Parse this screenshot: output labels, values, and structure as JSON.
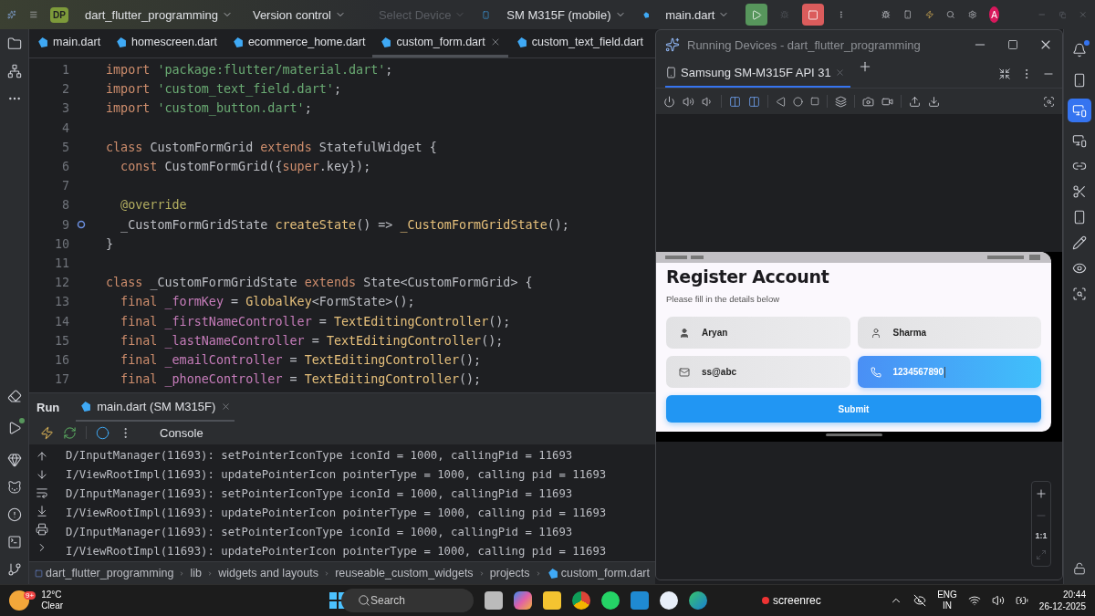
{
  "title_bar": {
    "project_badge": "DP",
    "project": "dart_flutter_programming",
    "vcs": "Version control",
    "device_selector": {
      "label": "Select Device",
      "disabled": true
    },
    "device": "SM M315F (mobile)",
    "run_config": "main.dart",
    "avatar": "A"
  },
  "editor_tabs": [
    {
      "label": "main.dart",
      "selected": false
    },
    {
      "label": "homescreen.dart",
      "selected": false
    },
    {
      "label": "ecommerce_home.dart",
      "selected": false
    },
    {
      "label": "custom_form.dart",
      "selected": true
    },
    {
      "label": "custom_text_field.dart",
      "selected": false
    }
  ],
  "code_lines": [
    {
      "number": "1",
      "marker": false,
      "tokens": [
        {
          "kind": "kw",
          "t": "import "
        },
        {
          "kind": "str",
          "t": "'package:flutter/material.dart'"
        },
        {
          "kind": "plain",
          "t": ";"
        }
      ]
    },
    {
      "number": "2",
      "marker": false,
      "tokens": [
        {
          "kind": "kw",
          "t": "import "
        },
        {
          "kind": "str",
          "t": "'custom_text_field.dart'"
        },
        {
          "kind": "plain",
          "t": ";"
        }
      ]
    },
    {
      "number": "3",
      "marker": false,
      "tokens": [
        {
          "kind": "kw",
          "t": "import "
        },
        {
          "kind": "str",
          "t": "'custom_button.dart'"
        },
        {
          "kind": "plain",
          "t": ";"
        }
      ]
    },
    {
      "number": "4",
      "marker": false
    },
    {
      "number": "5",
      "marker": false,
      "tokens": [
        {
          "kind": "kw",
          "t": "class "
        },
        {
          "kind": "plain",
          "t": "CustomFormGrid "
        },
        {
          "kind": "kw",
          "t": "extends "
        },
        {
          "kind": "plain",
          "t": "StatefulWidget {"
        }
      ]
    },
    {
      "number": "6",
      "marker": false,
      "tokens": [
        {
          "kind": "kw",
          "t": "  const "
        },
        {
          "kind": "plain",
          "t": "CustomFormGrid({"
        },
        {
          "kind": "kw",
          "t": "super"
        },
        {
          "kind": "plain",
          "t": ".key});"
        }
      ]
    },
    {
      "number": "7",
      "marker": false
    },
    {
      "number": "8",
      "marker": false,
      "tokens": [
        {
          "kind": "ann",
          "t": "  @override"
        }
      ]
    },
    {
      "number": "9",
      "marker": true,
      "tokens": [
        {
          "kind": "plain",
          "t": "  _CustomFormGridState "
        },
        {
          "kind": "fn",
          "t": "createState"
        },
        {
          "kind": "plain",
          "t": "() => "
        },
        {
          "kind": "fn",
          "t": "_CustomFormGridState"
        },
        {
          "kind": "plain",
          "t": "();"
        }
      ]
    },
    {
      "number": "10",
      "marker": false,
      "tokens": [
        {
          "kind": "plain",
          "t": "}"
        }
      ]
    },
    {
      "number": "11",
      "marker": false
    },
    {
      "number": "12",
      "marker": false,
      "tokens": [
        {
          "kind": "kw",
          "t": "class "
        },
        {
          "kind": "plain",
          "t": "_CustomFormGridState "
        },
        {
          "kind": "kw",
          "t": "extends "
        },
        {
          "kind": "plain",
          "t": "State<CustomFormGrid> {"
        }
      ]
    },
    {
      "number": "13",
      "marker": false,
      "tokens": [
        {
          "kind": "kw",
          "t": "  final "
        },
        {
          "kind": "field",
          "t": "_formKey"
        },
        {
          "kind": "plain",
          "t": " = "
        },
        {
          "kind": "fn",
          "t": "GlobalKey"
        },
        {
          "kind": "plain",
          "t": "<FormState>();"
        }
      ]
    },
    {
      "number": "14",
      "marker": false,
      "tokens": [
        {
          "kind": "kw",
          "t": "  final "
        },
        {
          "kind": "field",
          "t": "_firstNameController"
        },
        {
          "kind": "plain",
          "t": " = "
        },
        {
          "kind": "fn",
          "t": "TextEditingController"
        },
        {
          "kind": "plain",
          "t": "();"
        }
      ]
    },
    {
      "number": "15",
      "marker": false,
      "tokens": [
        {
          "kind": "kw",
          "t": "  final "
        },
        {
          "kind": "field",
          "t": "_lastNameController"
        },
        {
          "kind": "plain",
          "t": " = "
        },
        {
          "kind": "fn",
          "t": "TextEditingController"
        },
        {
          "kind": "plain",
          "t": "();"
        }
      ]
    },
    {
      "number": "16",
      "marker": false,
      "tokens": [
        {
          "kind": "kw",
          "t": "  final "
        },
        {
          "kind": "field",
          "t": "_emailController"
        },
        {
          "kind": "plain",
          "t": " = "
        },
        {
          "kind": "fn",
          "t": "TextEditingController"
        },
        {
          "kind": "plain",
          "t": "();"
        }
      ]
    },
    {
      "number": "17",
      "marker": false,
      "tokens": [
        {
          "kind": "kw",
          "t": "  final "
        },
        {
          "kind": "field",
          "t": "_phoneController"
        },
        {
          "kind": "plain",
          "t": " = "
        },
        {
          "kind": "fn",
          "t": "TextEditingController"
        },
        {
          "kind": "plain",
          "t": "();"
        }
      ]
    }
  ],
  "run_panel": {
    "title": "Run",
    "tab": "main.dart (SM M315F)",
    "console_label": "Console",
    "lines": [
      "D/InputManager(11693): setPointerIconType iconId = 1000, callingPid = 11693",
      "I/ViewRootImpl(11693): updatePointerIcon pointerType = 1000, calling pid = 11693",
      "D/InputManager(11693): setPointerIconType iconId = 1000, callingPid = 11693",
      "I/ViewRootImpl(11693): updatePointerIcon pointerType = 1000, calling pid = 11693",
      "D/InputManager(11693): setPointerIconType iconId = 1000, callingPid = 11693",
      "I/ViewRootImpl(11693): updatePointerIcon pointerType = 1000, calling pid = 11693"
    ]
  },
  "breadcrumb": [
    "dart_flutter_programming",
    "lib",
    "widgets and layouts",
    "reuseable_custom_widgets",
    "projects",
    "custom_form.dart"
  ],
  "device_window": {
    "title": "Running Devices - dart_flutter_programming",
    "tab": "Samsung SM-M315F API 31",
    "zoom_label": "1:1",
    "app": {
      "heading": "Register Account",
      "subtitle": "Please fill in the details below",
      "submit": "Submit",
      "fields": [
        {
          "kind": "person",
          "value": "Aryan",
          "focused": false
        },
        {
          "kind": "person-outline",
          "value": "Sharma",
          "focused": false
        },
        {
          "kind": "email",
          "value": "ss@abc",
          "focused": false
        },
        {
          "kind": "phone",
          "value": "1234567890",
          "focused": true
        }
      ]
    }
  },
  "taskbar": {
    "weather": {
      "badge": "9+",
      "temp": "12°C",
      "condition": "Clear"
    },
    "search_placeholder": "Search",
    "recorder": "screenrec",
    "language": "ENG",
    "region": "IN",
    "time": "20:44",
    "date": "26-12-2025"
  }
}
